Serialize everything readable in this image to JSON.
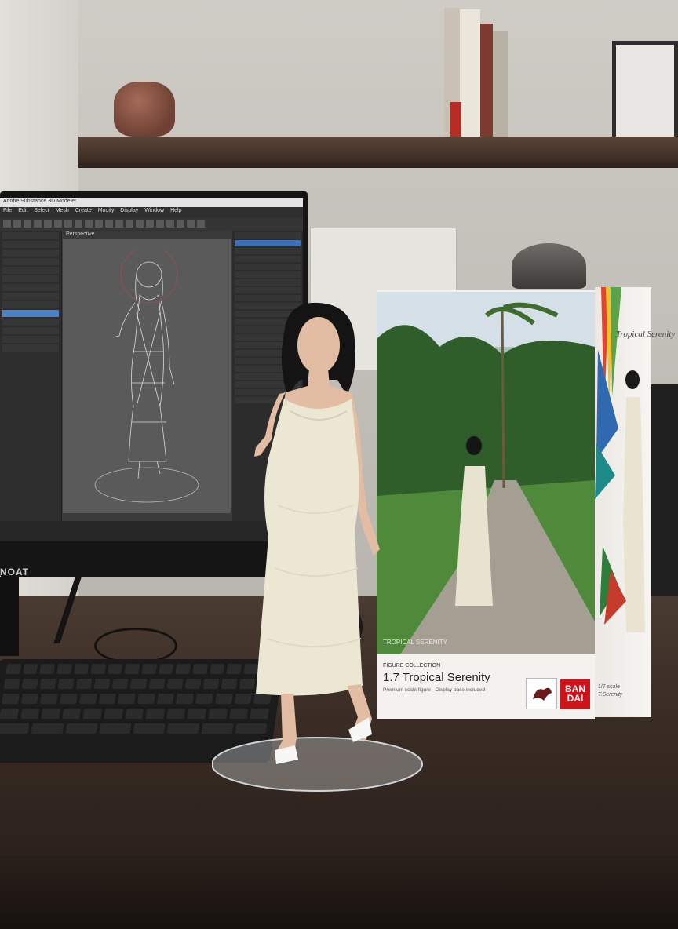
{
  "scene": {
    "description_type": "photo of a figurine on a desk beside a monitor and its retail box",
    "colors": {
      "wall": "#c6c3bd",
      "desk": "#3a2d25",
      "shelf": "#3f2f25",
      "bandai_red": "#d0121b",
      "dress": "#ece7d3",
      "hair": "#141414"
    }
  },
  "monitor": {
    "brand": "NOAT",
    "app": {
      "titlebar": "Adobe Substance 3D Modeler",
      "menu": [
        "File",
        "Edit",
        "Select",
        "Mesh",
        "Create",
        "Modify",
        "Display",
        "Window",
        "Help"
      ],
      "left_panel_rows": 14,
      "viewport_label": "Perspective",
      "right_panel_rows": 22
    }
  },
  "box": {
    "subtitle": "FIGURE COLLECTION",
    "title": "1.7 Tropical Serenity",
    "description": "Premium scale figure · Display base included",
    "photo_overlay": "TROPICAL SERENITY",
    "side_title": "Tropical Serenity",
    "side_footer": "1/7 scale",
    "side_footer2": "T.Serenity",
    "brand_logo": "BAN DAI",
    "brand_logo_line1": "BAN",
    "brand_logo_line2": "DAI"
  },
  "icons": [
    "bandai-logo-icon",
    "bird-logo-icon"
  ]
}
